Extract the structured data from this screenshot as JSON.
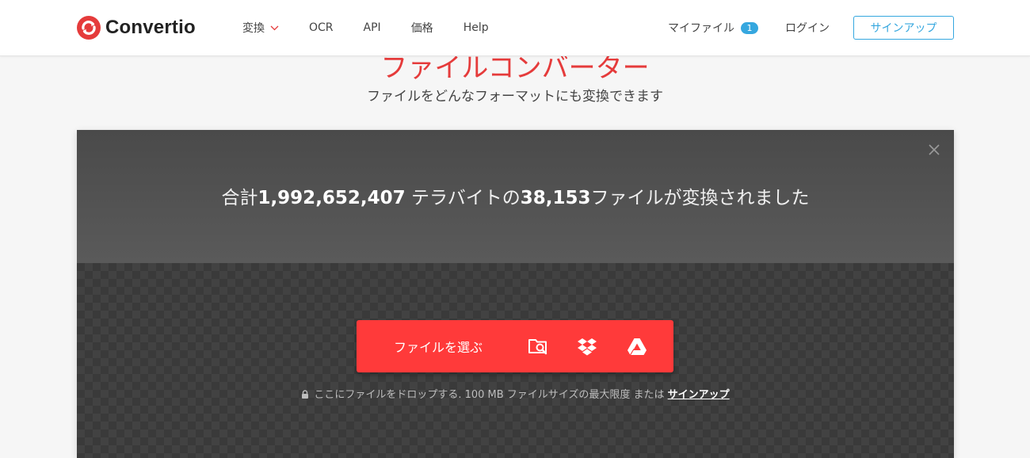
{
  "brand": {
    "name": "Convertio",
    "accent": "#e53b3b",
    "link_color": "#35a7df"
  },
  "nav": {
    "items": [
      {
        "label": "変換",
        "has_dropdown": true
      },
      {
        "label": "OCR"
      },
      {
        "label": "API"
      },
      {
        "label": "価格"
      },
      {
        "label": "Help"
      }
    ]
  },
  "user_nav": {
    "my_files_label": "マイファイル",
    "my_files_count": "1",
    "login_label": "ログイン",
    "signup_label": "サインアップ"
  },
  "hero": {
    "title": "ファイルコンバーター",
    "subtitle": "ファイルをどんなフォーマットにも変換できます"
  },
  "stats": {
    "prefix": "合計",
    "terabytes": "1,992,652,407",
    "middle": " テラバイトの",
    "files": "38,153",
    "suffix": "ファイルが変換されました"
  },
  "upload": {
    "choose_label": "ファイルを選ぶ",
    "sources": [
      "folder-search-icon",
      "dropbox-icon",
      "google-drive-icon"
    ],
    "note_text": "ここにファイルをドロップする. 100 MB ファイルサイズの最大限度 または ",
    "note_link": "サインアップ"
  }
}
